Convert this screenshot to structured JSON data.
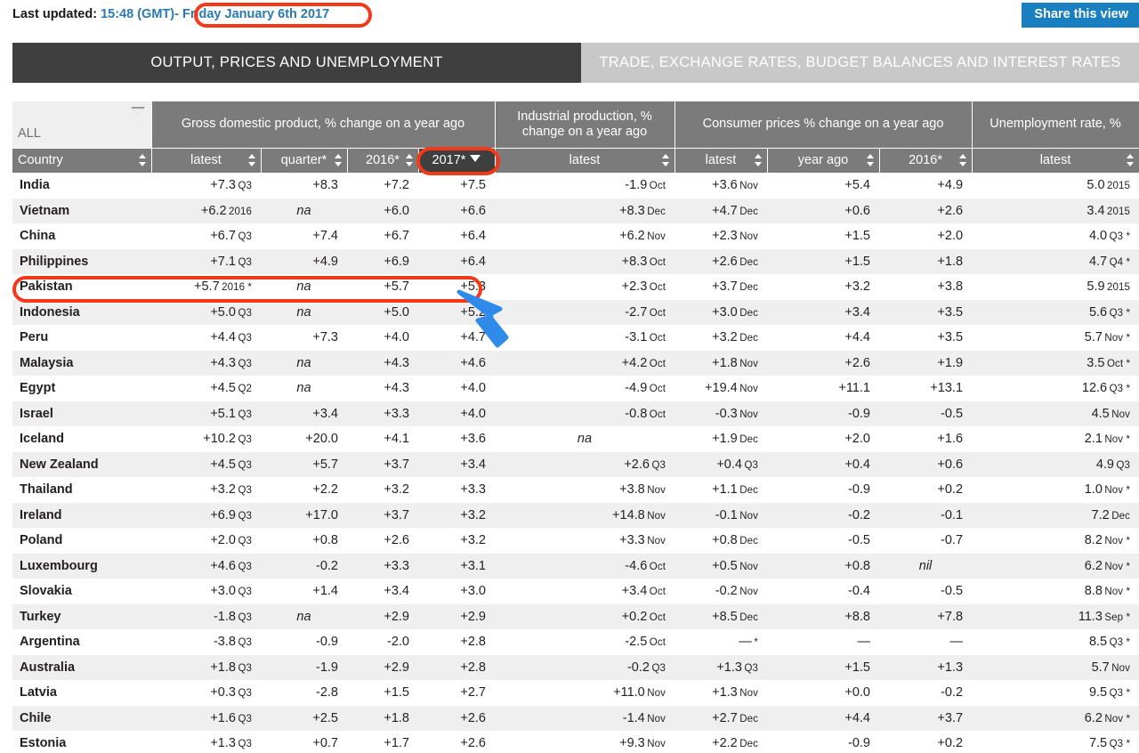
{
  "header": {
    "last_updated_label": "Last updated:",
    "time": "15:48 (GMT)",
    "separator": "-",
    "date": "Friday January 6th 2017",
    "share_button": "Share this view"
  },
  "tabs": [
    {
      "label": "OUTPUT, PRICES AND UNEMPLOYMENT",
      "active": true
    },
    {
      "label": "TRADE, EXCHANGE RATES, BUDGET BALANCES AND INTEREST RATES",
      "active": false
    }
  ],
  "filter": {
    "value": "ALL",
    "icon": "filter-caret-icon"
  },
  "table": {
    "group_headers": [
      {
        "label": "",
        "span": 1
      },
      {
        "label": "Gross domestic product, % change on a year ago",
        "span": 4
      },
      {
        "label": "Industrial production, % change on a year ago",
        "span": 1
      },
      {
        "label": "Consumer prices % change on a year ago",
        "span": 3
      },
      {
        "label": "Unemployment rate, %",
        "span": 1
      }
    ],
    "sub_headers": [
      {
        "label": "Country",
        "sorted": false,
        "align": "left"
      },
      {
        "label": "latest",
        "sorted": false
      },
      {
        "label": "quarter*",
        "sorted": false
      },
      {
        "label": "2016*",
        "sorted": false
      },
      {
        "label": "2017*",
        "sorted": true
      },
      {
        "label": "latest",
        "sorted": false
      },
      {
        "label": "latest",
        "sorted": false
      },
      {
        "label": "year ago",
        "sorted": false
      },
      {
        "label": "2016*",
        "sorted": false
      },
      {
        "label": "latest",
        "sorted": false
      }
    ],
    "rows": [
      {
        "country": "India",
        "gdp_latest": "+7.3",
        "gdp_latest_period": "Q3",
        "gdp_quarter": "+8.3",
        "gdp_2016": "+7.2",
        "gdp_2017": "+7.5",
        "ip_latest": "-1.9",
        "ip_period": "Oct",
        "cpi_latest": "+3.6",
        "cpi_period": "Nov",
        "cpi_year_ago": "+5.4",
        "cpi_2016": "+4.9",
        "unemp": "5.0",
        "unemp_period": "2015"
      },
      {
        "country": "Vietnam",
        "gdp_latest": "+6.2",
        "gdp_latest_period": "2016",
        "gdp_quarter": "na",
        "gdp_2016": "+6.0",
        "gdp_2017": "+6.6",
        "ip_latest": "+8.3",
        "ip_period": "Dec",
        "cpi_latest": "+4.7",
        "cpi_period": "Dec",
        "cpi_year_ago": "+0.6",
        "cpi_2016": "+2.6",
        "unemp": "3.4",
        "unemp_period": "2015"
      },
      {
        "country": "China",
        "gdp_latest": "+6.7",
        "gdp_latest_period": "Q3",
        "gdp_quarter": "+7.4",
        "gdp_2016": "+6.7",
        "gdp_2017": "+6.4",
        "ip_latest": "+6.2",
        "ip_period": "Nov",
        "cpi_latest": "+2.3",
        "cpi_period": "Nov",
        "cpi_year_ago": "+1.5",
        "cpi_2016": "+2.0",
        "unemp": "4.0",
        "unemp_period": "Q3 *"
      },
      {
        "country": "Philippines",
        "gdp_latest": "+7.1",
        "gdp_latest_period": "Q3",
        "gdp_quarter": "+4.9",
        "gdp_2016": "+6.9",
        "gdp_2017": "+6.4",
        "ip_latest": "+8.3",
        "ip_period": "Oct",
        "cpi_latest": "+2.6",
        "cpi_period": "Dec",
        "cpi_year_ago": "+1.5",
        "cpi_2016": "+1.8",
        "unemp": "4.7",
        "unemp_period": "Q4 *"
      },
      {
        "country": "Pakistan",
        "gdp_latest": "+5.7",
        "gdp_latest_period": "2016 *",
        "gdp_quarter": "na",
        "gdp_2016": "+5.7",
        "gdp_2017": "+5.3",
        "ip_latest": "+2.3",
        "ip_period": "Oct",
        "cpi_latest": "+3.7",
        "cpi_period": "Dec",
        "cpi_year_ago": "+3.2",
        "cpi_2016": "+3.8",
        "unemp": "5.9",
        "unemp_period": "2015"
      },
      {
        "country": "Indonesia",
        "gdp_latest": "+5.0",
        "gdp_latest_period": "Q3",
        "gdp_quarter": "na",
        "gdp_2016": "+5.0",
        "gdp_2017": "+5.2",
        "ip_latest": "-2.7",
        "ip_period": "Oct",
        "cpi_latest": "+3.0",
        "cpi_period": "Dec",
        "cpi_year_ago": "+3.4",
        "cpi_2016": "+3.5",
        "unemp": "5.6",
        "unemp_period": "Q3 *"
      },
      {
        "country": "Peru",
        "gdp_latest": "+4.4",
        "gdp_latest_period": "Q3",
        "gdp_quarter": "+7.3",
        "gdp_2016": "+4.0",
        "gdp_2017": "+4.7",
        "ip_latest": "-3.1",
        "ip_period": "Oct",
        "cpi_latest": "+3.2",
        "cpi_period": "Dec",
        "cpi_year_ago": "+4.4",
        "cpi_2016": "+3.5",
        "unemp": "5.7",
        "unemp_period": "Nov *"
      },
      {
        "country": "Malaysia",
        "gdp_latest": "+4.3",
        "gdp_latest_period": "Q3",
        "gdp_quarter": "na",
        "gdp_2016": "+4.3",
        "gdp_2017": "+4.6",
        "ip_latest": "+4.2",
        "ip_period": "Oct",
        "cpi_latest": "+1.8",
        "cpi_period": "Nov",
        "cpi_year_ago": "+2.6",
        "cpi_2016": "+1.9",
        "unemp": "3.5",
        "unemp_period": "Oct *"
      },
      {
        "country": "Egypt",
        "gdp_latest": "+4.5",
        "gdp_latest_period": "Q2",
        "gdp_quarter": "na",
        "gdp_2016": "+4.3",
        "gdp_2017": "+4.0",
        "ip_latest": "-4.9",
        "ip_period": "Oct",
        "cpi_latest": "+19.4",
        "cpi_period": "Nov",
        "cpi_year_ago": "+11.1",
        "cpi_2016": "+13.1",
        "unemp": "12.6",
        "unemp_period": "Q3 *"
      },
      {
        "country": "Israel",
        "gdp_latest": "+5.1",
        "gdp_latest_period": "Q3",
        "gdp_quarter": "+3.4",
        "gdp_2016": "+3.3",
        "gdp_2017": "+4.0",
        "ip_latest": "-0.8",
        "ip_period": "Oct",
        "cpi_latest": "-0.3",
        "cpi_period": "Nov",
        "cpi_year_ago": "-0.9",
        "cpi_2016": "-0.5",
        "unemp": "4.5",
        "unemp_period": "Nov"
      },
      {
        "country": "Iceland",
        "gdp_latest": "+10.2",
        "gdp_latest_period": "Q3",
        "gdp_quarter": "+20.0",
        "gdp_2016": "+4.1",
        "gdp_2017": "+3.6",
        "ip_latest": "na",
        "ip_period": "",
        "cpi_latest": "+1.9",
        "cpi_period": "Dec",
        "cpi_year_ago": "+2.0",
        "cpi_2016": "+1.6",
        "unemp": "2.1",
        "unemp_period": "Nov *"
      },
      {
        "country": "New Zealand",
        "gdp_latest": "+4.5",
        "gdp_latest_period": "Q3",
        "gdp_quarter": "+5.7",
        "gdp_2016": "+3.7",
        "gdp_2017": "+3.4",
        "ip_latest": "+2.6",
        "ip_period": "Q3",
        "cpi_latest": "+0.4",
        "cpi_period": "Q3",
        "cpi_year_ago": "+0.4",
        "cpi_2016": "+0.6",
        "unemp": "4.9",
        "unemp_period": "Q3"
      },
      {
        "country": "Thailand",
        "gdp_latest": "+3.2",
        "gdp_latest_period": "Q3",
        "gdp_quarter": "+2.2",
        "gdp_2016": "+3.2",
        "gdp_2017": "+3.3",
        "ip_latest": "+3.8",
        "ip_period": "Nov",
        "cpi_latest": "+1.1",
        "cpi_period": "Dec",
        "cpi_year_ago": "-0.9",
        "cpi_2016": "+0.2",
        "unemp": "1.0",
        "unemp_period": "Nov *"
      },
      {
        "country": "Ireland",
        "gdp_latest": "+6.9",
        "gdp_latest_period": "Q3",
        "gdp_quarter": "+17.0",
        "gdp_2016": "+3.7",
        "gdp_2017": "+3.2",
        "ip_latest": "+14.8",
        "ip_period": "Nov",
        "cpi_latest": "-0.1",
        "cpi_period": "Nov",
        "cpi_year_ago": "-0.2",
        "cpi_2016": "-0.1",
        "unemp": "7.2",
        "unemp_period": "Dec"
      },
      {
        "country": "Poland",
        "gdp_latest": "+2.0",
        "gdp_latest_period": "Q3",
        "gdp_quarter": "+0.8",
        "gdp_2016": "+2.6",
        "gdp_2017": "+3.2",
        "ip_latest": "+3.3",
        "ip_period": "Nov",
        "cpi_latest": "+0.8",
        "cpi_period": "Dec",
        "cpi_year_ago": "-0.5",
        "cpi_2016": "-0.7",
        "unemp": "8.2",
        "unemp_period": "Nov *"
      },
      {
        "country": "Luxembourg",
        "gdp_latest": "+4.6",
        "gdp_latest_period": "Q3",
        "gdp_quarter": "-0.2",
        "gdp_2016": "+3.3",
        "gdp_2017": "+3.1",
        "ip_latest": "-4.6",
        "ip_period": "Oct",
        "cpi_latest": "+0.5",
        "cpi_period": "Nov",
        "cpi_year_ago": "+0.8",
        "cpi_2016": "nil",
        "unemp": "6.2",
        "unemp_period": "Nov *"
      },
      {
        "country": "Slovakia",
        "gdp_latest": "+3.0",
        "gdp_latest_period": "Q3",
        "gdp_quarter": "+1.4",
        "gdp_2016": "+3.4",
        "gdp_2017": "+3.0",
        "ip_latest": "+3.4",
        "ip_period": "Oct",
        "cpi_latest": "-0.2",
        "cpi_period": "Nov",
        "cpi_year_ago": "-0.4",
        "cpi_2016": "-0.5",
        "unemp": "8.8",
        "unemp_period": "Nov *"
      },
      {
        "country": "Turkey",
        "gdp_latest": "-1.8",
        "gdp_latest_period": "Q3",
        "gdp_quarter": "na",
        "gdp_2016": "+2.9",
        "gdp_2017": "+2.9",
        "ip_latest": "+0.2",
        "ip_period": "Oct",
        "cpi_latest": "+8.5",
        "cpi_period": "Dec",
        "cpi_year_ago": "+8.8",
        "cpi_2016": "+7.8",
        "unemp": "11.3",
        "unemp_period": "Sep *"
      },
      {
        "country": "Argentina",
        "gdp_latest": "-3.8",
        "gdp_latest_period": "Q3",
        "gdp_quarter": "-0.9",
        "gdp_2016": "-2.0",
        "gdp_2017": "+2.8",
        "ip_latest": "-2.5",
        "ip_period": "Oct",
        "cpi_latest": "—",
        "cpi_period": "*",
        "cpi_year_ago": "—",
        "cpi_2016": "—",
        "unemp": "8.5",
        "unemp_period": "Q3 *"
      },
      {
        "country": "Australia",
        "gdp_latest": "+1.8",
        "gdp_latest_period": "Q3",
        "gdp_quarter": "-1.9",
        "gdp_2016": "+2.9",
        "gdp_2017": "+2.8",
        "ip_latest": "-0.2",
        "ip_period": "Q3",
        "cpi_latest": "+1.3",
        "cpi_period": "Q3",
        "cpi_year_ago": "+1.5",
        "cpi_2016": "+1.3",
        "unemp": "5.7",
        "unemp_period": "Nov"
      },
      {
        "country": "Latvia",
        "gdp_latest": "+0.3",
        "gdp_latest_period": "Q3",
        "gdp_quarter": "-2.8",
        "gdp_2016": "+1.5",
        "gdp_2017": "+2.7",
        "ip_latest": "+11.0",
        "ip_period": "Nov",
        "cpi_latest": "+1.3",
        "cpi_period": "Nov",
        "cpi_year_ago": "+0.0",
        "cpi_2016": "-0.2",
        "unemp": "9.5",
        "unemp_period": "Q3 *"
      },
      {
        "country": "Chile",
        "gdp_latest": "+1.6",
        "gdp_latest_period": "Q3",
        "gdp_quarter": "+2.5",
        "gdp_2016": "+1.8",
        "gdp_2017": "+2.6",
        "ip_latest": "-1.4",
        "ip_period": "Nov",
        "cpi_latest": "+2.7",
        "cpi_period": "Dec",
        "cpi_year_ago": "+4.4",
        "cpi_2016": "+3.7",
        "unemp": "6.2",
        "unemp_period": "Nov *"
      },
      {
        "country": "Estonia",
        "gdp_latest": "+1.3",
        "gdp_latest_period": "Q3",
        "gdp_quarter": "+0.7",
        "gdp_2016": "+1.7",
        "gdp_2017": "+2.6",
        "ip_latest": "+9.3",
        "ip_period": "Nov",
        "cpi_latest": "+2.2",
        "cpi_period": "Dec",
        "cpi_year_ago": "-0.9",
        "cpi_2016": "+0.2",
        "unemp": "7.5",
        "unemp_period": "Q3 *"
      }
    ]
  },
  "annotations": {
    "highlight_color": "#f4381a",
    "arrow_color": "#2e8bea",
    "circled": [
      "date",
      "2017*-column-header",
      "Pakistan-row"
    ],
    "arrow_target": "Pakistan-row"
  },
  "colors": {
    "accent_blue": "#1a7fc1",
    "link_blue": "#2a7ab0",
    "tab_active": "#3f3f3f",
    "tab_inactive": "#c8c8c8",
    "header_gray": "#7b7b7b",
    "stripe": "#efefef"
  }
}
